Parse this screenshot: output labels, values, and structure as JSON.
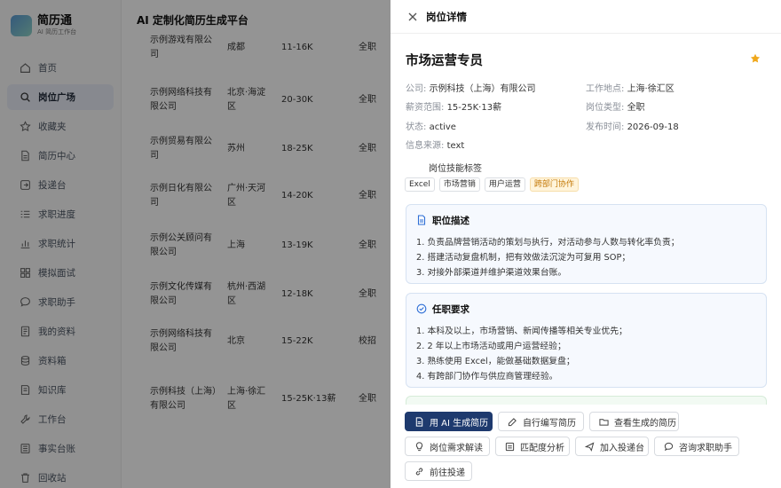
{
  "sidebar": {
    "app_name": "简历通",
    "app_subtitle": "AI 简历工作台",
    "items": [
      {
        "label": "首页"
      },
      {
        "label": "岗位广场"
      },
      {
        "label": "收藏夹"
      },
      {
        "label": "简历中心"
      },
      {
        "label": "投递台"
      },
      {
        "label": "求职进度"
      },
      {
        "label": "求职统计"
      },
      {
        "label": "模拟面试"
      },
      {
        "label": "求职助手"
      },
      {
        "label": "我的资料"
      },
      {
        "label": "资料箱"
      },
      {
        "label": "知识库"
      },
      {
        "label": "工作台"
      },
      {
        "label": "事实台账"
      },
      {
        "label": "回收站"
      }
    ]
  },
  "main": {
    "header": "AI 定制化简历生成平台",
    "rows": [
      {
        "company": "示例游戏有限公司",
        "city": "成都",
        "salary": "11-16K",
        "type": "全职"
      },
      {
        "company": "示例网络科技有限公司",
        "city": "北京·海淀区",
        "salary": "20-30K",
        "type": "全职"
      },
      {
        "company": "示例贸易有限公司",
        "city": "苏州",
        "salary": "18-25K",
        "type": "全职"
      },
      {
        "company": "示例日化有限公司",
        "city": "广州·天河区",
        "salary": "14-20K",
        "type": "全职"
      },
      {
        "company": "示例公关顾问有限公司",
        "city": "上海",
        "salary": "13-19K",
        "type": "全职"
      },
      {
        "company": "示例文化传媒有限公司",
        "city": "杭州·西湖区",
        "salary": "12-18K",
        "type": "全职"
      },
      {
        "company": "示例网络科技有限公司",
        "city": "北京",
        "salary": "15-22K",
        "type": "校招"
      },
      {
        "company": "示例科技（上海）有限公司",
        "city": "上海·徐汇区",
        "salary": "15-25K·13薪",
        "type": "全职"
      }
    ]
  },
  "drawer": {
    "header": "岗位详情",
    "job_title": "市场运营专员",
    "info": {
      "company_label": "公司:",
      "company": "示例科技（上海）有限公司",
      "location_label": "工作地点:",
      "location": "上海·徐汇区",
      "salary_label": "薪资范围:",
      "salary": "15-25K·13薪",
      "jobtype_label": "岗位类型:",
      "jobtype": "全职",
      "status_label": "状态:",
      "status": "active",
      "published_label": "发布时间:",
      "published": "2026-09-18",
      "source_label": "信息来源:",
      "source": "text"
    },
    "tags_title": "岗位技能标签",
    "tags": [
      "Excel",
      "市场营销",
      "用户运营",
      "跨部门协作"
    ],
    "description": {
      "title": "职位描述",
      "lines": [
        "1. 负责品牌营销活动的策划与执行，对活动参与人数与转化率负责；",
        "2. 搭建活动复盘机制，把有效做法沉淀为可复用 SOP；",
        "3. 对接外部渠道并维护渠道效果台账。"
      ]
    },
    "requirements": {
      "title": "任职要求",
      "lines": [
        "1. 本科及以上，市场营销、新闻传播等相关专业优先；",
        "2. 2 年以上市场活动或用户运营经验；",
        "3. 熟练使用 Excel，能做基础数据复盘；",
        "4. 有跨部门协作与供应商管理经验。"
      ]
    },
    "actions": {
      "ai_generate": "用 AI 生成简历",
      "self_write": "自行编写简历",
      "view_generated": "查看生成的简历",
      "job_analysis": "岗位需求解读",
      "match_analysis": "匹配度分析",
      "add_to_queue": "加入投递台",
      "ask_assistant": "咨询求职助手",
      "go_apply": "前往投递"
    }
  },
  "colors": {
    "primary": "#1e3a6e",
    "star": "#f0a81c",
    "tag_warn": "#fff4db"
  }
}
